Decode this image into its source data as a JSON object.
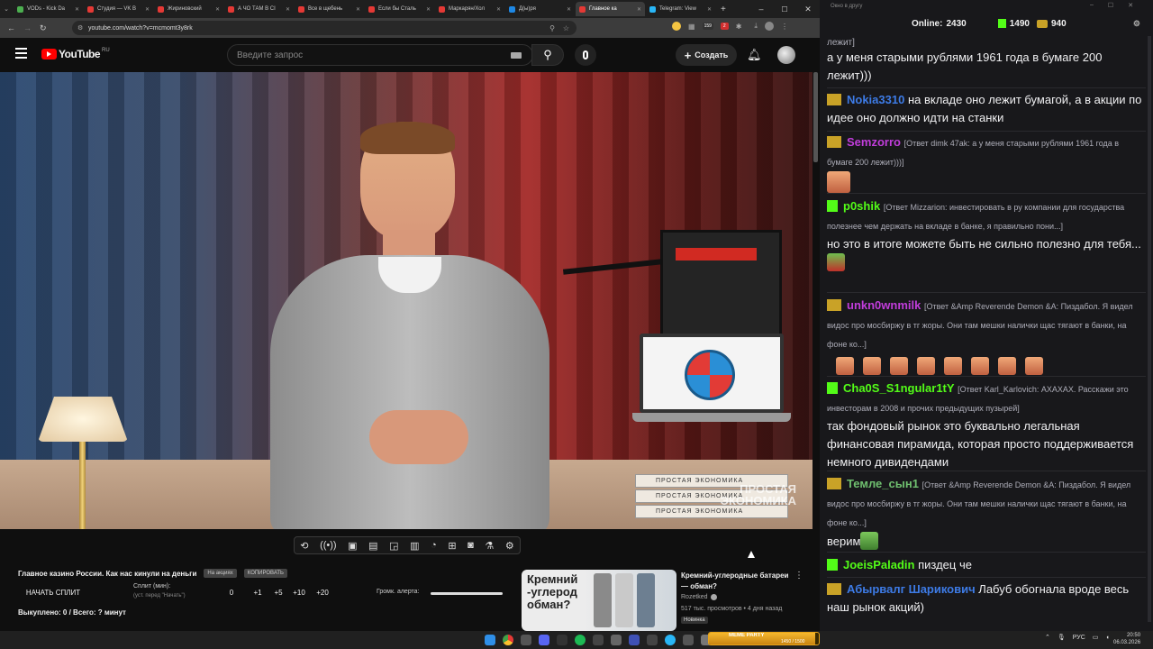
{
  "browser": {
    "tabs": [
      {
        "label": "VODs - Kick Da",
        "color": "#4caf50"
      },
      {
        "label": "Студия — VK В",
        "color": "#e53935"
      },
      {
        "label": "Жириновский",
        "color": "#e53935"
      },
      {
        "label": "А ЧО ТАМ В СІ",
        "color": "#e53935"
      },
      {
        "label": "Все в щебень",
        "color": "#e53935"
      },
      {
        "label": "Если бы Сталь",
        "color": "#e53935"
      },
      {
        "label": "Маркарян/Хол",
        "color": "#e53935"
      },
      {
        "label": "Д(ы)ря",
        "color": "#1e88e5"
      },
      {
        "label": "Главное ка",
        "color": "#e53935",
        "active": true
      },
      {
        "label": "Telegram: View",
        "color": "#29b6f6"
      }
    ],
    "url": "youtube.com/watch?v=mcmomt3y8rk",
    "ext_badge_1": "159",
    "ext_badge_2": "2"
  },
  "youtube": {
    "logo": "YouTube",
    "region": "RU",
    "search_placeholder": "Введите запрос",
    "create_label": "Создать",
    "video_title": "Главное казино России. Как нас кинули на деньги",
    "watermark": "ПРОСТАЯ\nЭКОНОМИКА",
    "book_text": "ПРОСТАЯ ЭКОНОМИКА",
    "chip_1": "На акциях",
    "chip_2": "КОПИРОВАТЬ",
    "split_button": "НАЧАТЬ СПЛИТ",
    "split_label": "Сплит (мин):",
    "split_hint": "(уст. перед \"Начать\")",
    "split_values": [
      "0",
      "+1",
      "+5",
      "+10",
      "+20"
    ],
    "alert_label": "Громк. алерта:",
    "bought": "Выкуплено: 0 / Всего: ? минут",
    "rec_title": "Кремний-углеродные батареи — обман?",
    "rec_channel": "Rozetked",
    "rec_meta": "517 тыс. просмотров • 4 дня назад",
    "rec_badge": "Новинка",
    "thumb_text": "Кремний\n-углерод\nобман?"
  },
  "chat": {
    "title": "Окно в другу",
    "online_label": "Online:",
    "online_count": "2430",
    "kick_count": "1490",
    "other_count": "940",
    "messages": [
      {
        "text": "лежит]"
      },
      {
        "text": "а у меня старыми рублями 1961 года в бумаге 200 лежит)))"
      },
      {
        "user": "Nokia3310",
        "color": "#3d7be6",
        "text": "на вкладе оно лежит бумагой, а в акции по идее оно должно идти на станки"
      },
      {
        "user": "Semzorro",
        "color": "#c13ddb",
        "reply": "[Ответ dimk 47ak: а у меня старыми рублями 1961 года в бумаге 200 лежит)))]"
      },
      {
        "user": "p0shik",
        "color": "#53fc18",
        "reply": "[Ответ Mizzarion: инвестировать в ру компании для государства полезнее чем держать на вкладе в банке, я правильно пони...]",
        "text": "но это в итоге можете быть не сильно полезно для тебя..."
      },
      {
        "user": "unkn0wnmilk",
        "color": "#c13ddb",
        "reply": "[Ответ &Amp Reverende Demon &A: Пиздабол. Я видел видос про мосбиржу в тг жоры. Они там мешки налички щас тягают в банки, на фоне ко...]"
      },
      {
        "user": "Cha0S_S1ngular1tY",
        "color": "#53fc18",
        "reply": "[Ответ Karl_Karlovich: АХАХАХ. Расскажи это инвесторам в 2008 и прочих предыдущих пузырей]",
        "text": "так фондовый рынок это буквально легальная финансовая пирамида, которая просто поддерживается немного дивидендами"
      },
      {
        "user": "Темле_сын1",
        "color": "#6fbf6f",
        "reply": "[Ответ &Amp Reverende Demon &A: Пиздабол. Я видел видос про мосбиржу в тг жоры. Они там мешки налички щас тягают в банки, на фоне ко...]",
        "text": "верим"
      },
      {
        "user": "JoeisPaladin",
        "color": "#53fc18",
        "text": "пиздец че"
      },
      {
        "user": "Абырвалг Шарикович",
        "color": "#3d7be6",
        "text": "Лабуб обогнала вроде весь наш рынок акций)"
      }
    ]
  },
  "taskbar": {
    "lang": "РУС",
    "time": "20:50",
    "date": "06.03.2026",
    "meme_label": "MEME PARTY",
    "meme_progress": "1450 / 1500"
  }
}
